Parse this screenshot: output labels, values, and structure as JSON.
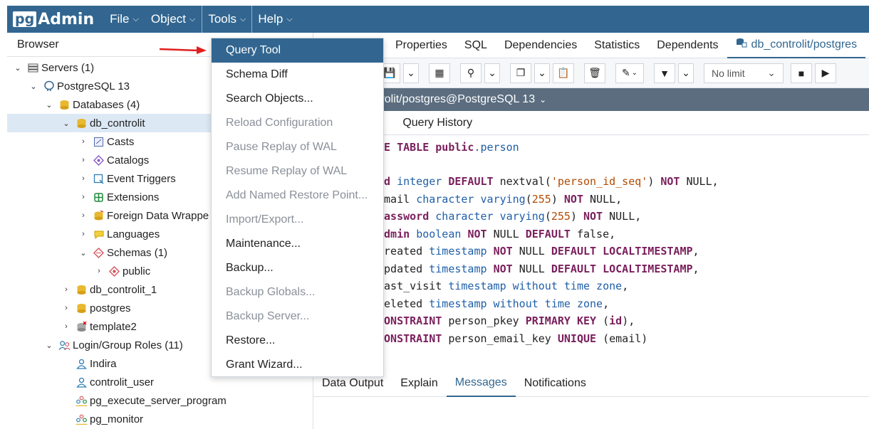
{
  "navbar": {
    "logo_pg": "pg",
    "logo_admin": "Admin",
    "menus": [
      "File",
      "Object",
      "Tools",
      "Help"
    ]
  },
  "browser": {
    "title": "Browser",
    "tree": [
      {
        "label": "Servers (1)",
        "icon": "servers-icon"
      },
      {
        "label": "PostgreSQL 13",
        "icon": "elephant-icon"
      },
      {
        "label": "Databases (4)",
        "icon": "databases-icon"
      },
      {
        "label": "db_controlit",
        "icon": "database-icon"
      },
      {
        "label": "Casts",
        "icon": "casts-icon"
      },
      {
        "label": "Catalogs",
        "icon": "catalogs-icon"
      },
      {
        "label": "Event Triggers",
        "icon": "event-triggers-icon"
      },
      {
        "label": "Extensions",
        "icon": "extensions-icon"
      },
      {
        "label": "Foreign Data Wrappe",
        "icon": "foreign-data-icon"
      },
      {
        "label": "Languages",
        "icon": "languages-icon"
      },
      {
        "label": "Schemas (1)",
        "icon": "schemas-icon"
      },
      {
        "label": "public",
        "icon": "schema-public-icon"
      },
      {
        "label": "db_controlit_1",
        "icon": "database-icon"
      },
      {
        "label": "postgres",
        "icon": "database-icon"
      },
      {
        "label": "template2",
        "icon": "database-disconnected-icon"
      },
      {
        "label": "Login/Group Roles (11)",
        "icon": "roles-icon"
      },
      {
        "label": "Indira",
        "icon": "user-icon"
      },
      {
        "label": "controlit_user",
        "icon": "user-icon"
      },
      {
        "label": "pg_execute_server_program",
        "icon": "group-icon"
      },
      {
        "label": "pg_monitor",
        "icon": "group-icon"
      }
    ]
  },
  "tabs": [
    "Properties",
    "SQL",
    "Dependencies",
    "Statistics",
    "Dependents",
    "db_controlit/postgres"
  ],
  "toolbar": {
    "limit_label": "No limit"
  },
  "connection": "trolit/postgres@PostgreSQL 13",
  "query_tabs": [
    "r",
    "Query History"
  ],
  "code": {
    "l1a": "TE TABLE ",
    "l1b": "public",
    "l1c": ".person",
    "l3a": "id ",
    "l3b": "integer ",
    "l3c": "DEFAULT ",
    "l3d": "nextval(",
    "l3e": "'person_id_seq'",
    "l3f": ") ",
    "l3g": "NOT ",
    "l3h": "NULL,",
    "l4a": "email ",
    "l4b": "character varying",
    "l4c": "(",
    "l4d": "255",
    "l4e": ") ",
    "l4f": "NOT ",
    "l4g": "NULL,",
    "l5a": "password ",
    "l5b": "character varying",
    "l5c": "(",
    "l5d": "255",
    "l5e": ") ",
    "l5f": "NOT ",
    "l5g": "NULL,",
    "l6a": "admin ",
    "l6b": "boolean ",
    "l6c": "NOT ",
    "l6d": "NULL ",
    "l6e": "DEFAULT ",
    "l6f": "false,",
    "l7a": "created ",
    "l7b": "timestamp ",
    "l7c": "NOT ",
    "l7d": "NULL ",
    "l7e": "DEFAULT ",
    "l7f": "LOCALTIMESTAMP",
    "l8a": "updated ",
    "l8b": "timestamp ",
    "l8c": "NOT ",
    "l8d": "NULL ",
    "l8e": "DEFAULT ",
    "l8f": "LOCALTIMESTAMP",
    "l9a": "last_visit ",
    "l9b": "timestamp without time zone",
    "l9c": ",",
    "l10a": "deleted ",
    "l10b": "timestamp without time zone",
    "l10c": ",",
    "l11a": "CONSTRAINT ",
    "l11b": "person_pkey ",
    "l11c": "PRIMARY KEY ",
    "l11d": "(",
    "l11e": "id",
    "l11f": "),",
    "l12a": "CONSTRAINT ",
    "l12b": "person_email_key ",
    "l12c": "UNIQUE ",
    "l12d": "(email)"
  },
  "bottom_tabs": [
    "Data Output",
    "Explain",
    "Messages",
    "Notifications"
  ],
  "tools_menu": [
    {
      "label": "Query Tool",
      "state": "highlighted"
    },
    {
      "label": "Schema Diff",
      "state": "enabled"
    },
    {
      "label": "Search Objects...",
      "state": "enabled"
    },
    {
      "label": "Reload Configuration",
      "state": "disabled"
    },
    {
      "label": "Pause Replay of WAL",
      "state": "disabled"
    },
    {
      "label": "Resume Replay of WAL",
      "state": "disabled"
    },
    {
      "label": "Add Named Restore Point...",
      "state": "disabled"
    },
    {
      "label": "Import/Export...",
      "state": "disabled"
    },
    {
      "label": "Maintenance...",
      "state": "enabled"
    },
    {
      "label": "Backup...",
      "state": "enabled"
    },
    {
      "label": "Backup Globals...",
      "state": "disabled"
    },
    {
      "label": "Backup Server...",
      "state": "disabled"
    },
    {
      "label": "Restore...",
      "state": "enabled"
    },
    {
      "label": "Grant Wizard...",
      "state": "enabled"
    }
  ],
  "colors": {
    "brand": "#326690",
    "highlight": "#326690",
    "selection": "#dce9f5",
    "arrow": "#e02020"
  }
}
